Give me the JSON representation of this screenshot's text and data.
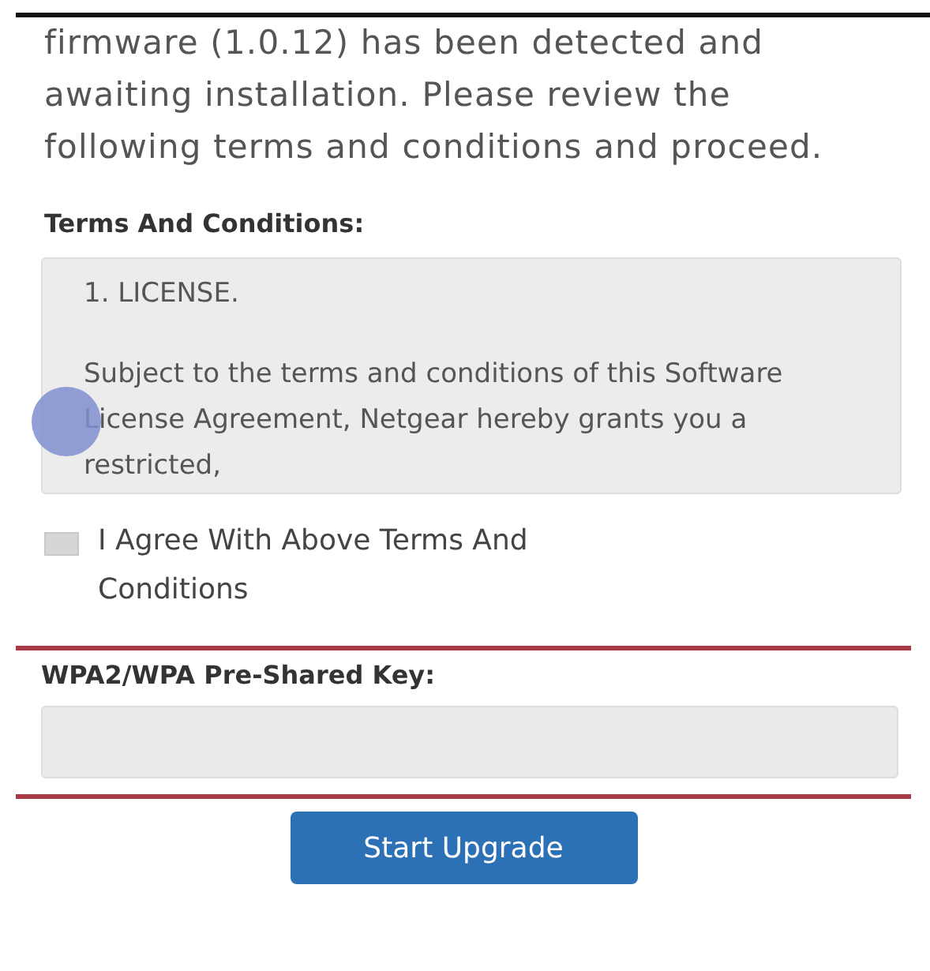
{
  "intro": "firmware (1.0.12) has been detected and awaiting installation. Please review the following terms and conditions and proceed.",
  "terms": {
    "heading": "Terms And Conditions:",
    "paragraphs": [
      "1. LICENSE.",
      "Subject to the terms and conditions of this Software License Agreement, Netgear hereby grants you a restricted,"
    ]
  },
  "agree": {
    "label": "I Agree With Above Terms And Conditions",
    "checked": false
  },
  "psk": {
    "label": "WPA2/WPA Pre-Shared Key:"
  },
  "buttons": [
    {
      "label": "Start Upgrade"
    }
  ]
}
